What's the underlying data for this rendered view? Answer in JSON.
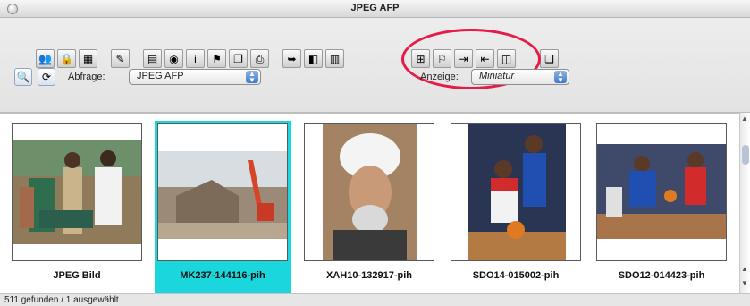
{
  "window": {
    "title": "JPEG AFP"
  },
  "toolbar": {
    "buttons": [
      {
        "name": "linked-people-icon",
        "glyph": "👥"
      },
      {
        "name": "lock-icon",
        "glyph": "🔒"
      },
      {
        "name": "grid-icon",
        "glyph": "▦"
      },
      {
        "name": "pencil-icon",
        "glyph": "✎"
      },
      {
        "name": "document-view-icon",
        "glyph": "▤"
      },
      {
        "name": "eye-icon",
        "glyph": "◉"
      },
      {
        "name": "info-icon",
        "glyph": "i"
      },
      {
        "name": "flag-icon",
        "glyph": "⚑"
      },
      {
        "name": "copy-icon",
        "glyph": "❐"
      },
      {
        "name": "print-icon",
        "glyph": "⎙"
      },
      {
        "name": "forward-icon",
        "glyph": "➥"
      },
      {
        "name": "layers-icon",
        "glyph": "◧"
      },
      {
        "name": "stats-icon",
        "glyph": "▥"
      },
      {
        "name": "tree-icon",
        "glyph": "⊞"
      },
      {
        "name": "page-flag-icon",
        "glyph": "⚐"
      },
      {
        "name": "export-icon",
        "glyph": "⇥"
      },
      {
        "name": "import-icon",
        "glyph": "⇤"
      },
      {
        "name": "split-icon",
        "glyph": "◫"
      },
      {
        "name": "stack-icon",
        "glyph": "❏"
      }
    ]
  },
  "query": {
    "label": "Abfrage:",
    "value": "JPEG AFP",
    "display_label": "Anzeige:",
    "display_value": "Miniatur"
  },
  "thumbnails": [
    {
      "caption": "JPEG Bild",
      "selected": false
    },
    {
      "caption": "MK237-144116-pih",
      "selected": true
    },
    {
      "caption": "XAH10-132917-pih",
      "selected": false
    },
    {
      "caption": "SDO14-015002-pih",
      "selected": false
    },
    {
      "caption": "SDO12-014423-pih",
      "selected": false
    }
  ],
  "status": {
    "text": "511 gefunden / 1 ausgewählt"
  },
  "colors": {
    "selection": "#1ad7de",
    "highlight_ring": "#e51b4a"
  }
}
